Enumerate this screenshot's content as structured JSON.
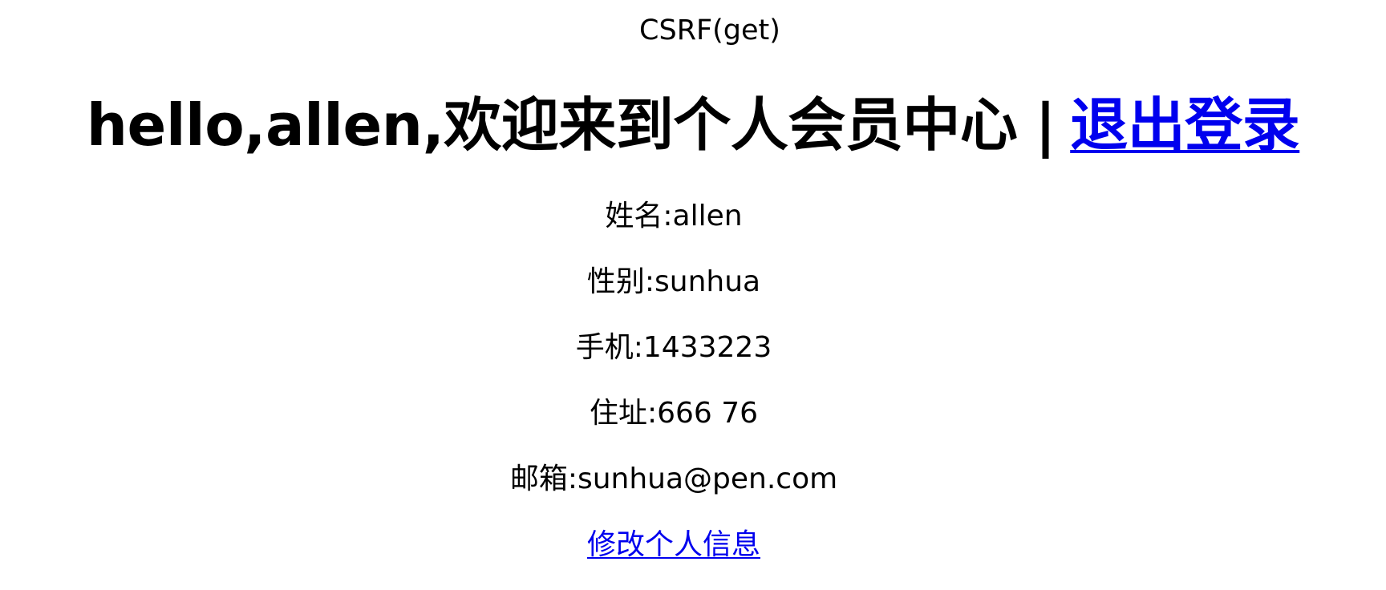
{
  "header": {
    "title": "CSRF(get)"
  },
  "welcome": {
    "text": "hello,allen,欢迎来到个人会员中心",
    "separator": "|",
    "logout_link": "退出登录"
  },
  "profile": {
    "name_label": "姓名:",
    "name_value": "allen",
    "gender_label": "性别:",
    "gender_value": "sunhua",
    "phone_label": "手机:",
    "phone_value": "1433223",
    "address_label": "住址:",
    "address_value": "666 76",
    "email_label": "邮箱:",
    "email_value": "sunhua@pen.com"
  },
  "actions": {
    "edit_profile_link": "修改个人信息"
  },
  "colors": {
    "link": "#0000ee",
    "text": "#000000",
    "background": "#ffffff"
  }
}
